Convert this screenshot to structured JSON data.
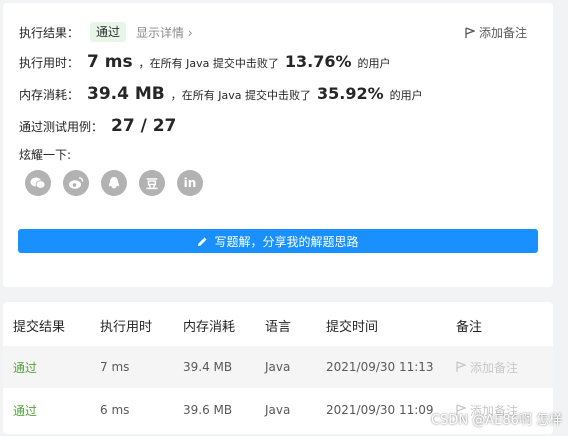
{
  "result": {
    "label": "执行结果：",
    "status": "通过",
    "details": "显示详情 ›",
    "add_note": "添加备注"
  },
  "runtime": {
    "label": "执行用时：",
    "value": "7 ms",
    "prefix": "，在所有 Java 提交中击败了",
    "percent": "13.76%",
    "suffix": "的用户"
  },
  "memory": {
    "label": "内存消耗：",
    "value": "39.4 MB",
    "prefix": "，在所有 Java 提交中击败了",
    "percent": "35.92%",
    "suffix": "的用户"
  },
  "tests": {
    "label": "通过测试用例：",
    "value": "27 / 27"
  },
  "share": {
    "label": "炫耀一下:",
    "icons": [
      "wechat-icon",
      "weibo-icon",
      "qq-icon",
      "douban-icon",
      "linkedin-icon"
    ],
    "douban_glyph": "豆",
    "linkedin_glyph": "in"
  },
  "write_button": "写题解，分享我的解题思路",
  "table": {
    "headers": [
      "提交结果",
      "执行用时",
      "内存消耗",
      "语言",
      "提交时间",
      "备注"
    ],
    "rows": [
      {
        "status": "通过",
        "runtime": "7 ms",
        "memory": "39.4 MB",
        "lang": "Java",
        "time": "2021/09/30 11:13",
        "note": "添加备注"
      },
      {
        "status": "通过",
        "runtime": "6 ms",
        "memory": "39.6 MB",
        "lang": "Java",
        "time": "2021/09/30 11:09",
        "note": "添加备注"
      }
    ]
  },
  "watermark": "CSDN @AE86啊 怎样",
  "colors": {
    "accent": "#1a90ff",
    "success": "#52a33a"
  }
}
